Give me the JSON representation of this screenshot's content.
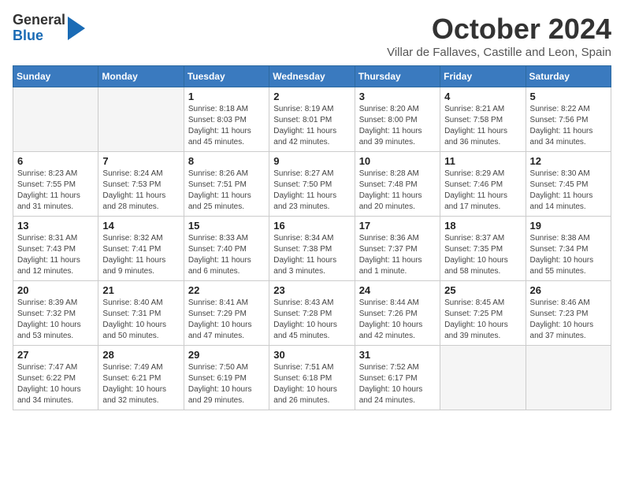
{
  "logo": {
    "general": "General",
    "blue": "Blue"
  },
  "header": {
    "month": "October 2024",
    "location": "Villar de Fallaves, Castille and Leon, Spain"
  },
  "weekdays": [
    "Sunday",
    "Monday",
    "Tuesday",
    "Wednesday",
    "Thursday",
    "Friday",
    "Saturday"
  ],
  "weeks": [
    [
      {
        "day": "",
        "info": ""
      },
      {
        "day": "",
        "info": ""
      },
      {
        "day": "1",
        "info": "Sunrise: 8:18 AM\nSunset: 8:03 PM\nDaylight: 11 hours and 45 minutes."
      },
      {
        "day": "2",
        "info": "Sunrise: 8:19 AM\nSunset: 8:01 PM\nDaylight: 11 hours and 42 minutes."
      },
      {
        "day": "3",
        "info": "Sunrise: 8:20 AM\nSunset: 8:00 PM\nDaylight: 11 hours and 39 minutes."
      },
      {
        "day": "4",
        "info": "Sunrise: 8:21 AM\nSunset: 7:58 PM\nDaylight: 11 hours and 36 minutes."
      },
      {
        "day": "5",
        "info": "Sunrise: 8:22 AM\nSunset: 7:56 PM\nDaylight: 11 hours and 34 minutes."
      }
    ],
    [
      {
        "day": "6",
        "info": "Sunrise: 8:23 AM\nSunset: 7:55 PM\nDaylight: 11 hours and 31 minutes."
      },
      {
        "day": "7",
        "info": "Sunrise: 8:24 AM\nSunset: 7:53 PM\nDaylight: 11 hours and 28 minutes."
      },
      {
        "day": "8",
        "info": "Sunrise: 8:26 AM\nSunset: 7:51 PM\nDaylight: 11 hours and 25 minutes."
      },
      {
        "day": "9",
        "info": "Sunrise: 8:27 AM\nSunset: 7:50 PM\nDaylight: 11 hours and 23 minutes."
      },
      {
        "day": "10",
        "info": "Sunrise: 8:28 AM\nSunset: 7:48 PM\nDaylight: 11 hours and 20 minutes."
      },
      {
        "day": "11",
        "info": "Sunrise: 8:29 AM\nSunset: 7:46 PM\nDaylight: 11 hours and 17 minutes."
      },
      {
        "day": "12",
        "info": "Sunrise: 8:30 AM\nSunset: 7:45 PM\nDaylight: 11 hours and 14 minutes."
      }
    ],
    [
      {
        "day": "13",
        "info": "Sunrise: 8:31 AM\nSunset: 7:43 PM\nDaylight: 11 hours and 12 minutes."
      },
      {
        "day": "14",
        "info": "Sunrise: 8:32 AM\nSunset: 7:41 PM\nDaylight: 11 hours and 9 minutes."
      },
      {
        "day": "15",
        "info": "Sunrise: 8:33 AM\nSunset: 7:40 PM\nDaylight: 11 hours and 6 minutes."
      },
      {
        "day": "16",
        "info": "Sunrise: 8:34 AM\nSunset: 7:38 PM\nDaylight: 11 hours and 3 minutes."
      },
      {
        "day": "17",
        "info": "Sunrise: 8:36 AM\nSunset: 7:37 PM\nDaylight: 11 hours and 1 minute."
      },
      {
        "day": "18",
        "info": "Sunrise: 8:37 AM\nSunset: 7:35 PM\nDaylight: 10 hours and 58 minutes."
      },
      {
        "day": "19",
        "info": "Sunrise: 8:38 AM\nSunset: 7:34 PM\nDaylight: 10 hours and 55 minutes."
      }
    ],
    [
      {
        "day": "20",
        "info": "Sunrise: 8:39 AM\nSunset: 7:32 PM\nDaylight: 10 hours and 53 minutes."
      },
      {
        "day": "21",
        "info": "Sunrise: 8:40 AM\nSunset: 7:31 PM\nDaylight: 10 hours and 50 minutes."
      },
      {
        "day": "22",
        "info": "Sunrise: 8:41 AM\nSunset: 7:29 PM\nDaylight: 10 hours and 47 minutes."
      },
      {
        "day": "23",
        "info": "Sunrise: 8:43 AM\nSunset: 7:28 PM\nDaylight: 10 hours and 45 minutes."
      },
      {
        "day": "24",
        "info": "Sunrise: 8:44 AM\nSunset: 7:26 PM\nDaylight: 10 hours and 42 minutes."
      },
      {
        "day": "25",
        "info": "Sunrise: 8:45 AM\nSunset: 7:25 PM\nDaylight: 10 hours and 39 minutes."
      },
      {
        "day": "26",
        "info": "Sunrise: 8:46 AM\nSunset: 7:23 PM\nDaylight: 10 hours and 37 minutes."
      }
    ],
    [
      {
        "day": "27",
        "info": "Sunrise: 7:47 AM\nSunset: 6:22 PM\nDaylight: 10 hours and 34 minutes."
      },
      {
        "day": "28",
        "info": "Sunrise: 7:49 AM\nSunset: 6:21 PM\nDaylight: 10 hours and 32 minutes."
      },
      {
        "day": "29",
        "info": "Sunrise: 7:50 AM\nSunset: 6:19 PM\nDaylight: 10 hours and 29 minutes."
      },
      {
        "day": "30",
        "info": "Sunrise: 7:51 AM\nSunset: 6:18 PM\nDaylight: 10 hours and 26 minutes."
      },
      {
        "day": "31",
        "info": "Sunrise: 7:52 AM\nSunset: 6:17 PM\nDaylight: 10 hours and 24 minutes."
      },
      {
        "day": "",
        "info": ""
      },
      {
        "day": "",
        "info": ""
      }
    ]
  ]
}
